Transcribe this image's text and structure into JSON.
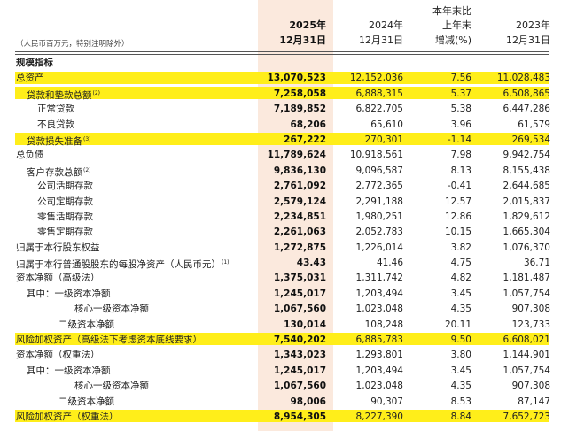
{
  "header": {
    "unit_note": "（人民币百万元，特别注明除外）",
    "col2025_year": "2025年",
    "col2025_date": "12月31日",
    "col2024_year": "2024年",
    "col2024_date": "12月31日",
    "change_l1": "本年末比",
    "change_l2": "上年末",
    "change_l3": "增减(%)",
    "col2023_year": "2023年",
    "col2023_date": "12月31日"
  },
  "rows": [
    {
      "label": "规模指标",
      "sup": "",
      "v2025": "",
      "v2024": "",
      "chg": "",
      "v2023": ""
    },
    {
      "label": "总资产",
      "sup": "",
      "v2025": "13,070,523",
      "v2024": "12,152,036",
      "chg": "7.56",
      "v2023": "11,028,483"
    },
    {
      "label": "贷款和垫款总额",
      "sup": "(2)",
      "v2025": "7,258,058",
      "v2024": "6,888,315",
      "chg": "5.37",
      "v2023": "6,508,865"
    },
    {
      "label": "正常贷款",
      "sup": "",
      "v2025": "7,189,852",
      "v2024": "6,822,705",
      "chg": "5.38",
      "v2023": "6,447,286"
    },
    {
      "label": "不良贷款",
      "sup": "",
      "v2025": "68,206",
      "v2024": "65,610",
      "chg": "3.96",
      "v2023": "61,579"
    },
    {
      "label": "贷款损失准备",
      "sup": "(3)",
      "v2025": "267,222",
      "v2024": "270,301",
      "chg": "-1.14",
      "v2023": "269,534"
    },
    {
      "label": "总负债",
      "sup": "",
      "v2025": "11,789,624",
      "v2024": "10,918,561",
      "chg": "7.98",
      "v2023": "9,942,754"
    },
    {
      "label": "客户存款总额",
      "sup": "(2)",
      "v2025": "9,836,130",
      "v2024": "9,096,587",
      "chg": "8.13",
      "v2023": "8,155,438"
    },
    {
      "label": "公司活期存款",
      "sup": "",
      "v2025": "2,761,092",
      "v2024": "2,772,365",
      "chg": "-0.41",
      "v2023": "2,644,685"
    },
    {
      "label": "公司定期存款",
      "sup": "",
      "v2025": "2,579,124",
      "v2024": "2,291,188",
      "chg": "12.57",
      "v2023": "2,015,837"
    },
    {
      "label": "零售活期存款",
      "sup": "",
      "v2025": "2,234,851",
      "v2024": "1,980,251",
      "chg": "12.86",
      "v2023": "1,829,612"
    },
    {
      "label": "零售定期存款",
      "sup": "",
      "v2025": "2,261,063",
      "v2024": "2,052,783",
      "chg": "10.15",
      "v2023": "1,665,304"
    },
    {
      "label": "归属于本行股东权益",
      "sup": "",
      "v2025": "1,272,875",
      "v2024": "1,226,014",
      "chg": "3.82",
      "v2023": "1,076,370"
    },
    {
      "label": "归属于本行普通股股东的每股净资产（人民币元）",
      "sup": "(1)",
      "v2025": "43.43",
      "v2024": "41.46",
      "chg": "4.75",
      "v2023": "36.71"
    },
    {
      "label": "资本净额（高级法）",
      "sup": "",
      "v2025": "1,375,031",
      "v2024": "1,311,742",
      "chg": "4.82",
      "v2023": "1,181,487"
    },
    {
      "label": "其中：一级资本净额",
      "sup": "",
      "v2025": "1,245,017",
      "v2024": "1,203,494",
      "chg": "3.45",
      "v2023": "1,057,754"
    },
    {
      "label": "核心一级资本净额",
      "sup": "",
      "v2025": "1,067,560",
      "v2024": "1,023,048",
      "chg": "4.35",
      "v2023": "907,308"
    },
    {
      "label": "二级资本净额",
      "sup": "",
      "v2025": "130,014",
      "v2024": "108,248",
      "chg": "20.11",
      "v2023": "123,733"
    },
    {
      "label": "风险加权资产（高级法下考虑资本底线要求）",
      "sup": "",
      "v2025": "7,540,202",
      "v2024": "6,885,783",
      "chg": "9.50",
      "v2023": "6,608,021"
    },
    {
      "label": "资本净额（权重法）",
      "sup": "",
      "v2025": "1,343,023",
      "v2024": "1,293,801",
      "chg": "3.80",
      "v2023": "1,144,901"
    },
    {
      "label": "其中：一级资本净额",
      "sup": "",
      "v2025": "1,245,017",
      "v2024": "1,203,494",
      "chg": "3.45",
      "v2023": "1,057,754"
    },
    {
      "label": "核心一级资本净额",
      "sup": "",
      "v2025": "1,067,560",
      "v2024": "1,023,048",
      "chg": "4.35",
      "v2023": "907,308"
    },
    {
      "label": "二级资本净额",
      "sup": "",
      "v2025": "98,006",
      "v2024": "90,307",
      "chg": "8.53",
      "v2023": "87,147"
    },
    {
      "label": "风险加权资产（权重法）",
      "sup": "",
      "v2025": "8,954,305",
      "v2024": "8,227,390",
      "chg": "8.84",
      "v2023": "7,652,723"
    }
  ],
  "colors": {
    "highlight": "#ffee1a",
    "column_2025": "#fbe9dd"
  }
}
